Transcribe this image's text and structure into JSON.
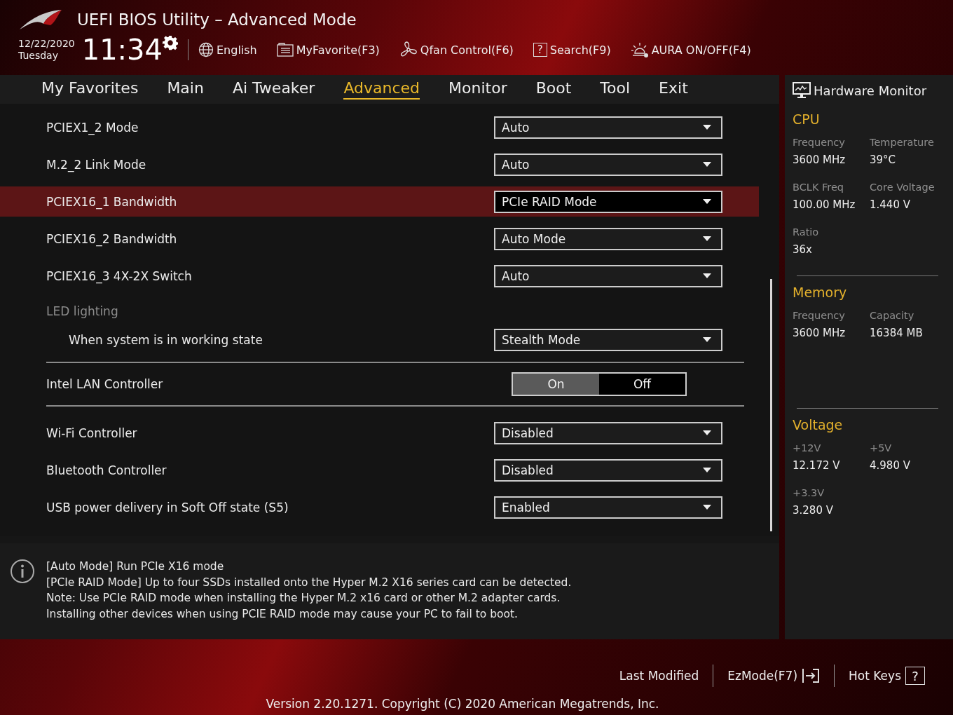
{
  "header": {
    "title": "UEFI BIOS Utility – Advanced Mode",
    "date": "12/22/2020",
    "day": "Tuesday",
    "time": "11:34",
    "tools": [
      {
        "kind": "globe",
        "label": "English"
      },
      {
        "kind": "favorite",
        "label": "MyFavorite(F3)"
      },
      {
        "kind": "fan",
        "label": "Qfan Control(F6)"
      },
      {
        "kind": "search",
        "glyph": "?",
        "label": "Search(F9)"
      },
      {
        "kind": "aura",
        "label": "AURA ON/OFF(F4)"
      }
    ]
  },
  "tabs": [
    {
      "label": "My Favorites",
      "selected": false
    },
    {
      "label": "Main",
      "selected": false
    },
    {
      "label": "Ai Tweaker",
      "selected": false
    },
    {
      "label": "Advanced",
      "selected": true
    },
    {
      "label": "Monitor",
      "selected": false
    },
    {
      "label": "Boot",
      "selected": false
    },
    {
      "label": "Tool",
      "selected": false
    },
    {
      "label": "Exit",
      "selected": false
    }
  ],
  "settings": [
    {
      "kind": "dropdown",
      "label": "PCIEX1_2 Mode",
      "value": "Auto",
      "selected": false
    },
    {
      "kind": "dropdown",
      "label": "M.2_2 Link Mode",
      "value": "Auto",
      "selected": false
    },
    {
      "kind": "dropdown",
      "label": "PCIEX16_1 Bandwidth",
      "value": "PCIe RAID Mode",
      "selected": true
    },
    {
      "kind": "dropdown",
      "label": "PCIEX16_2 Bandwidth",
      "value": "Auto Mode",
      "selected": false
    },
    {
      "kind": "dropdown",
      "label": "PCIEX16_3 4X-2X Switch",
      "value": "Auto",
      "selected": false
    },
    {
      "kind": "group",
      "label": "LED lighting",
      "children": [
        {
          "kind": "dropdown",
          "label": "When system is in working state",
          "value": "Stealth Mode",
          "selected": false
        }
      ]
    },
    {
      "kind": "toggle",
      "label": "Intel LAN Controller",
      "selected": false,
      "options": [
        {
          "label": "On",
          "selected": true
        },
        {
          "label": "Off",
          "selected": false
        }
      ]
    },
    {
      "kind": "dropdown",
      "label": "Wi-Fi Controller",
      "value": "Disabled",
      "selected": false
    },
    {
      "kind": "dropdown",
      "label": "Bluetooth Controller",
      "value": "Disabled",
      "selected": false
    },
    {
      "kind": "dropdown",
      "label": "USB power delivery in Soft Off state (S5)",
      "value": "Enabled",
      "selected": false
    }
  ],
  "help": {
    "lines": [
      "[Auto Mode] Run PCIe X16 mode",
      "[PCIe RAID Mode] Up to four SSDs installed onto the Hyper M.2 X16 series card can be detected.",
      "Note: Use PCIe RAID mode when installing the Hyper M.2 x16 card or other M.2 adapter cards.",
      "Installing other devices when using PCIE RAID mode may cause your PC to fail to boot."
    ]
  },
  "hardware_monitor": {
    "title": "Hardware Monitor",
    "sections": [
      {
        "title": "CPU",
        "items": [
          {
            "label": "Frequency",
            "value": "3600 MHz"
          },
          {
            "label": "Temperature",
            "value": "39°C"
          },
          {
            "label": "BCLK Freq",
            "value": "100.00 MHz"
          },
          {
            "label": "Core Voltage",
            "value": "1.440 V"
          },
          {
            "label": "Ratio",
            "value": "36x"
          }
        ]
      },
      {
        "title": "Memory",
        "items": [
          {
            "label": "Frequency",
            "value": "3600 MHz"
          },
          {
            "label": "Capacity",
            "value": "16384 MB"
          }
        ]
      },
      {
        "title": "Voltage",
        "items": [
          {
            "label": "+12V",
            "value": "12.172 V"
          },
          {
            "label": "+5V",
            "value": "4.980 V"
          },
          {
            "label": "+3.3V",
            "value": "3.280 V"
          }
        ]
      }
    ]
  },
  "footer": {
    "last_modified": "Last Modified",
    "ez_mode": "EzMode(F7)",
    "hot_keys": "Hot Keys",
    "hot_keys_glyph": "?",
    "version": "Version 2.20.1271. Copyright (C) 2020 American Megatrends, Inc."
  }
}
